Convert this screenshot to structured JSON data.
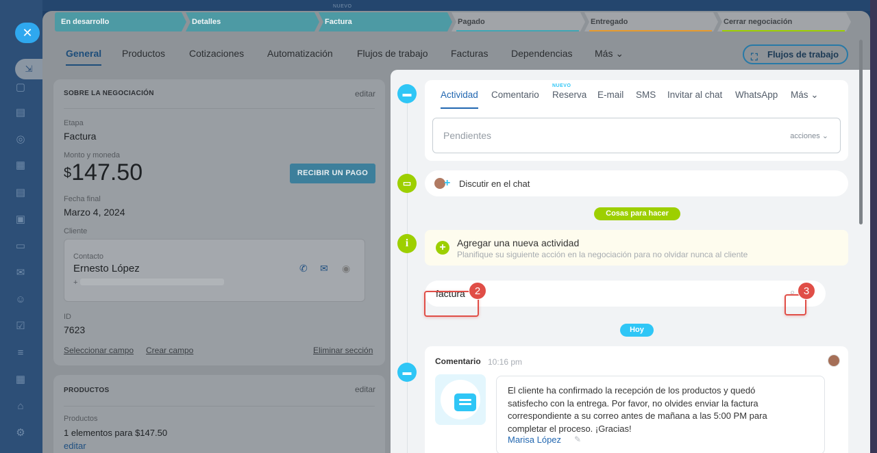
{
  "rail": {
    "close_icon": "close-icon",
    "pin_icon": "pin-icon",
    "icons": [
      "chat-icon",
      "document-icon",
      "target-icon",
      "calendar-icon",
      "file-icon",
      "presentation-icon",
      "card-icon",
      "mail-icon",
      "contacts-icon",
      "checkbox-icon",
      "filter-icon",
      "schedule-icon",
      "store-icon",
      "settings-icon"
    ]
  },
  "background": {
    "nuevo": "NUEVO"
  },
  "stages": [
    {
      "label": "En desarrollo",
      "state": "done",
      "color": "#4d9aa4"
    },
    {
      "label": "Detalles",
      "state": "done",
      "color": "#4d9aa4"
    },
    {
      "label": "Factura",
      "state": "current",
      "color": "#4d9aa4"
    },
    {
      "label": "Pagado",
      "state": "future",
      "underline": "#3fa6b4"
    },
    {
      "label": "Entregado",
      "state": "future",
      "underline": "#e89a2b"
    },
    {
      "label": "Cerrar negociación",
      "state": "future",
      "underline": "#9dcf00"
    }
  ],
  "tabs": [
    {
      "label": "General",
      "active": true
    },
    {
      "label": "Productos"
    },
    {
      "label": "Cotizaciones"
    },
    {
      "label": "Automatización"
    },
    {
      "label": "Flujos de trabajo"
    },
    {
      "label": "Facturas"
    },
    {
      "label": "Dependencias"
    },
    {
      "label": "Más"
    }
  ],
  "workflow_button": "Flujos de trabajo",
  "deal": {
    "header": "SOBRE LA NEGOCIACIÓN",
    "edit": "editar",
    "stage_label": "Etapa",
    "stage_value": "Factura",
    "amount_label": "Monto y moneda",
    "currency": "$",
    "amount": "147.50",
    "pay_button": "RECIBIR UN PAGO",
    "date_label": "Fecha final",
    "date_value": "Marzo 4, 2024",
    "client_label": "Cliente",
    "contact_label": "Contacto",
    "contact_name": "Ernesto López",
    "phone_prefix": "+",
    "id_label": "ID",
    "id_value": "7623",
    "select_field": "Seleccionar campo",
    "create_field": "Crear campo",
    "delete_section": "Eliminar sección"
  },
  "products": {
    "header": "PRODUCTOS",
    "edit": "editar",
    "label": "Productos",
    "value": "1 elementos para $147.50",
    "edit_link": "editar"
  },
  "activity": {
    "new_badge": "NUEVO",
    "tabs": [
      "Actividad",
      "Comentario",
      "Reserva",
      "E-mail",
      "SMS",
      "Invitar al chat",
      "WhatsApp",
      "Más"
    ],
    "pending_placeholder": "Pendientes",
    "actions": "acciones"
  },
  "chat": {
    "text": "Discutir en el chat"
  },
  "todo_pill": "Cosas para hacer",
  "todo": {
    "title": "Agregar una nueva actividad",
    "subtitle": "Planifique su siguiente acción en la negociación para no olvidar nunca al cliente"
  },
  "search": {
    "query": "factura"
  },
  "badges": {
    "two": "2",
    "three": "3"
  },
  "today_pill": "Hoy",
  "comment": {
    "title": "Comentario",
    "time": "10:16 pm",
    "body": "El cliente ha confirmado la recepción de los productos y quedó satisfecho con la entrega. Por favor, no olvides enviar la factura correspondiente a su correo antes de mañana a las 5:00 PM para completar el proceso. ¡Gracias!",
    "author": "Marisa López"
  },
  "colors": {
    "accent_blue": "#2fc6f6",
    "accent_green": "#9dcf00",
    "highlight_red": "#e04e47",
    "link_blue": "#2066b0"
  }
}
